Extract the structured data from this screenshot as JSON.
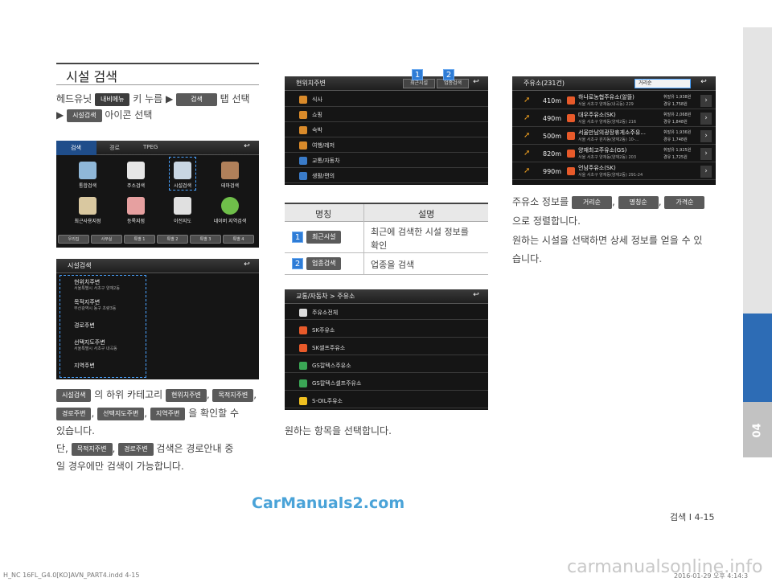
{
  "section_title": "시설 검색",
  "step1": {
    "prefix": "헤드유닛",
    "chip_nav": "내비메뉴",
    "mid": "키 누름 ▶",
    "chip_search": "검색",
    "suffix": "탭 선택"
  },
  "step2": {
    "arrow": "▶",
    "chip": "시설검색",
    "suffix": "아이콘 선택"
  },
  "screen1": {
    "tabs": [
      "검색",
      "경로",
      "TPEG"
    ],
    "icons": [
      "통합검색",
      "주소검색",
      "시설검색",
      "테마검색",
      "최근사용지점",
      "등록지점",
      "이전지도",
      "네이버 지역검색"
    ],
    "buttons": [
      "우리집",
      "사무실",
      "특별 1",
      "특별 2",
      "특별 3",
      "특별 4"
    ]
  },
  "screen2": {
    "title": "시설검색",
    "items": [
      {
        "name": "현위치주변",
        "sub": "서울특별시 서초구 양재2동"
      },
      {
        "name": "목적지주변",
        "sub": "부산광역시 동구 초량3동"
      },
      {
        "name": "경로주변",
        "sub": ""
      },
      {
        "name": "선택지도주변",
        "sub": "서울특별시 서초구 내곡동"
      },
      {
        "name": "지역주변",
        "sub": ""
      }
    ]
  },
  "desc1": {
    "chip_a": "시설검색",
    "t1": "의 하위 카테고리",
    "chip_b": "현위치주변",
    "chip_c": "목적지주변",
    "chip_d": "경로주변",
    "chip_e": "선택지도주변",
    "chip_f": "지역주변",
    "t2": "을 확인할 수",
    "t3": "있습니다.",
    "t4": "단,",
    "chip_g": "목적지주변",
    "chip_h": "경로주변",
    "t5": "검색은 경로안내 중",
    "t6": "일 경우에만 검색이 가능합니다."
  },
  "screen3": {
    "title": "현위치주변",
    "btn1": "최근시설",
    "btn2": "업종검색",
    "items": [
      "식사",
      "쇼핑",
      "숙박",
      "여행/레저",
      "교통/자동차",
      "생활/편의"
    ],
    "badge1": "1",
    "badge2": "2"
  },
  "table": {
    "col1": "명칭",
    "col2": "설명",
    "rows": [
      {
        "num": "1",
        "chip": "최근시설",
        "desc1": "최근에 검색한 시설 정보를",
        "desc2": "확인"
      },
      {
        "num": "2",
        "chip": "업종검색",
        "desc1": "업종을 검색",
        "desc2": ""
      }
    ]
  },
  "screen4": {
    "title": "교통/자동차 > 주유소",
    "items": [
      "주유소전체",
      "SK주유소",
      "SK셀프주유소",
      "GS칼텍스주유소",
      "GS칼텍스셀프주유소",
      "S-OIL주유소"
    ]
  },
  "desc2": "원하는 항목을 선택합니다.",
  "screen5": {
    "title": "주유소(231건)",
    "sort": "거리순",
    "rows": [
      {
        "dist": "410m",
        "name": "하나로농협주유소(알뜰)",
        "addr": "서울 서초구 양재동(내곡동) 229",
        "p1": "휘발유 1,938원",
        "p2": "경유 1,758원"
      },
      {
        "dist": "490m",
        "name": "대우주유소(SK)",
        "addr": "서울 서초구 양재동(양재2동) 216",
        "p1": "휘발유 2,068원",
        "p2": "경유 1,848원"
      },
      {
        "dist": "500m",
        "name": "서울만남의광장휴게소주유...",
        "addr": "서울 서초구 원지동(양재2동) 10-...",
        "p1": "휘발유 1,936원",
        "p2": "경유 1,748원"
      },
      {
        "dist": "820m",
        "name": "양재최고주유소(GS)",
        "addr": "서울 서초구 양재동(양재2동) 203",
        "p1": "휘발유 1,925원",
        "p2": "경유 1,725원"
      },
      {
        "dist": "990m",
        "name": "언남주유소(SK)",
        "addr": "서울 서초구 양재동(양재2동) 291-24",
        "p1": "",
        "p2": ""
      }
    ]
  },
  "desc3": {
    "t1": "주유소 정보를",
    "chip_a": "거리순",
    "chip_b": "명칭순",
    "chip_c": "가격순",
    "t2": "으로 정렬합니다.",
    "t3": "원하는 시설을 선택하면 상세 정보를 얻을 수 있",
    "t4": "습니다."
  },
  "side_tab": "04",
  "page_number": "검색 I 4-15",
  "footer_logo": "CarManuals2.com",
  "print_mark": "H_NC 16FL_G4.0[KO]AVN_PART4.indd   4-15",
  "print_date": "2016-01-29   오후 4:14:3",
  "watermark": "carmanualsonline.info"
}
